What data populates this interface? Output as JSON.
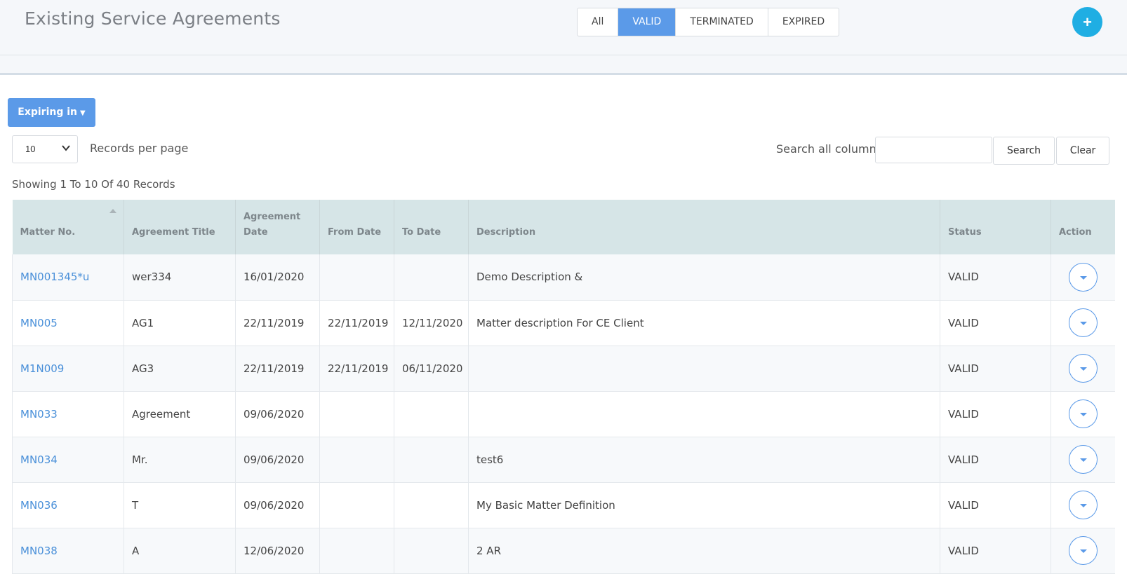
{
  "header": {
    "title": "Existing Service Agreements",
    "filter_tabs": [
      {
        "label": "All",
        "active": false
      },
      {
        "label": "VALID",
        "active": true
      },
      {
        "label": "TERMINATED",
        "active": false
      },
      {
        "label": "EXPIRED",
        "active": false
      }
    ],
    "add_icon": "plus-icon",
    "add_glyph": "+",
    "accent_color": "#5b9ae8",
    "add_button_color": "#1faee3"
  },
  "toolbar": {
    "expiring_label": "Expiring in",
    "records_per_page_value": "10",
    "records_per_page_label": "Records per page",
    "search_label": "Search all columns",
    "search_value": "",
    "search_button": "Search",
    "clear_button": "Clear",
    "showing_text": "Showing 1 To 10 Of 40 Records"
  },
  "table": {
    "columns": [
      "Matter No.",
      "Agreement Title",
      "Agreement Date",
      "From Date",
      "To Date",
      "Description",
      "Status",
      "Action"
    ],
    "rows": [
      {
        "matter_no": "MN001345*u",
        "title": "wer334",
        "agreement_date": "16/01/2020",
        "from_date": "",
        "to_date": "",
        "description": "Demo Description &",
        "status": "VALID"
      },
      {
        "matter_no": "MN005",
        "title": "AG1",
        "agreement_date": "22/11/2019",
        "from_date": "22/11/2019",
        "to_date": "12/11/2020",
        "description": "Matter description For CE Client",
        "status": "VALID"
      },
      {
        "matter_no": "M1N009",
        "title": "AG3",
        "agreement_date": "22/11/2019",
        "from_date": "22/11/2019",
        "to_date": "06/11/2020",
        "description": "",
        "status": "VALID"
      },
      {
        "matter_no": "MN033",
        "title": "Agreement",
        "agreement_date": "09/06/2020",
        "from_date": "",
        "to_date": "",
        "description": "",
        "status": "VALID"
      },
      {
        "matter_no": "MN034",
        "title": "Mr.",
        "agreement_date": "09/06/2020",
        "from_date": "",
        "to_date": "",
        "description": "test6",
        "status": "VALID"
      },
      {
        "matter_no": "MN036",
        "title": "T",
        "agreement_date": "09/06/2020",
        "from_date": "",
        "to_date": "",
        "description": "My Basic Matter Definition",
        "status": "VALID"
      },
      {
        "matter_no": "MN038",
        "title": "A",
        "agreement_date": "12/06/2020",
        "from_date": "",
        "to_date": "",
        "description": "2 AR",
        "status": "VALID"
      }
    ]
  }
}
